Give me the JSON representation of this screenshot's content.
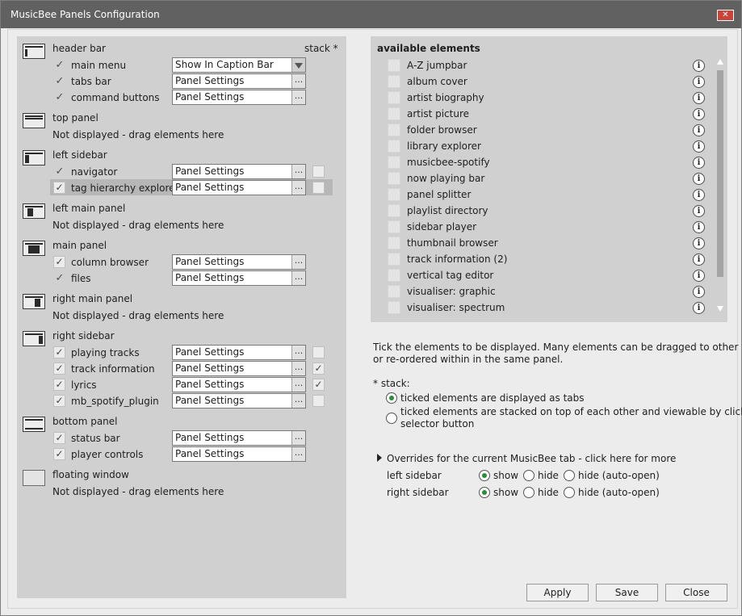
{
  "window": {
    "title": "MusicBee Panels Configuration",
    "close_glyph": "✕"
  },
  "layout_header": {
    "stack_label": "stack *"
  },
  "sections": {
    "header_bar": {
      "title": "header bar",
      "rows": [
        {
          "label": "main menu",
          "value": "Show In Caption Bar",
          "checked": true
        },
        {
          "label": "tabs bar",
          "value": "Panel Settings",
          "checked": true
        },
        {
          "label": "command buttons",
          "value": "Panel Settings",
          "checked": true
        }
      ]
    },
    "top_panel": {
      "title": "top panel",
      "empty_text": "Not displayed - drag elements here"
    },
    "left_sidebar": {
      "title": "left sidebar",
      "rows": [
        {
          "label": "navigator",
          "value": "Panel Settings",
          "checked": true
        },
        {
          "label": "tag hierarchy explorer",
          "value": "Panel Settings",
          "checked": true
        }
      ]
    },
    "left_main_panel": {
      "title": "left main panel",
      "empty_text": "Not displayed - drag elements here"
    },
    "main_panel": {
      "title": "main panel",
      "rows": [
        {
          "label": "column browser",
          "value": "Panel Settings",
          "checked": true
        },
        {
          "label": "files",
          "value": "Panel Settings",
          "checked": true
        }
      ]
    },
    "right_main_panel": {
      "title": "right main panel",
      "empty_text": "Not displayed - drag elements here"
    },
    "right_sidebar": {
      "title": "right sidebar",
      "rows": [
        {
          "label": "playing tracks",
          "value": "Panel Settings",
          "checked": true,
          "stack": false
        },
        {
          "label": "track information",
          "value": "Panel Settings",
          "checked": true,
          "stack": true
        },
        {
          "label": "lyrics",
          "value": "Panel Settings",
          "checked": true,
          "stack": true
        },
        {
          "label": "mb_spotify_plugin",
          "value": "Panel Settings",
          "checked": true,
          "stack": false
        }
      ]
    },
    "bottom_panel": {
      "title": "bottom panel",
      "rows": [
        {
          "label": "status bar",
          "value": "Panel Settings",
          "checked": true
        },
        {
          "label": "player controls",
          "value": "Panel Settings",
          "checked": true
        }
      ]
    },
    "floating_window": {
      "title": "floating window",
      "empty_text": "Not displayed - drag elements here"
    }
  },
  "available": {
    "title": "available elements",
    "items": [
      "A-Z jumpbar",
      "album cover",
      "artist biography",
      "artist picture",
      "folder browser",
      "library explorer",
      "musicbee-spotify",
      "now playing bar",
      "panel splitter",
      "playlist directory",
      "sidebar player",
      "thumbnail browser",
      "track information (2)",
      "vertical tag editor",
      "visualiser: graphic",
      "visualiser: spectrum"
    ],
    "info_glyph": "i"
  },
  "help": {
    "line1": "Tick the elements to be displayed. Many elements can be dragged to other panels",
    "line2": "or re-ordered within in the same panel.",
    "stack_title": "* stack:",
    "opt_tabs": "ticked elements are displayed as tabs",
    "opt_stacked_1": "ticked elements are stacked on top of each other and viewable by clicking a",
    "opt_stacked_2": "selector button",
    "selected_stack_option": "tabs"
  },
  "overrides": {
    "title": "Overrides for the current MusicBee tab - click here for more",
    "rows": [
      {
        "label": "left sidebar",
        "show": "show",
        "hide": "hide",
        "auto": "hide (auto-open)",
        "selected": "show"
      },
      {
        "label": "right sidebar",
        "show": "show",
        "hide": "hide",
        "auto": "hide (auto-open)",
        "selected": "show"
      }
    ]
  },
  "buttons": {
    "apply": "Apply",
    "save": "Save",
    "close": "Close"
  },
  "dots": "...",
  "check_glyph": "✓",
  "colors": {
    "title_bar": "#616161",
    "close_button": "#c8443a",
    "radio_selected": "#2b8c3a",
    "highlight_row": "#b7b7b7"
  }
}
